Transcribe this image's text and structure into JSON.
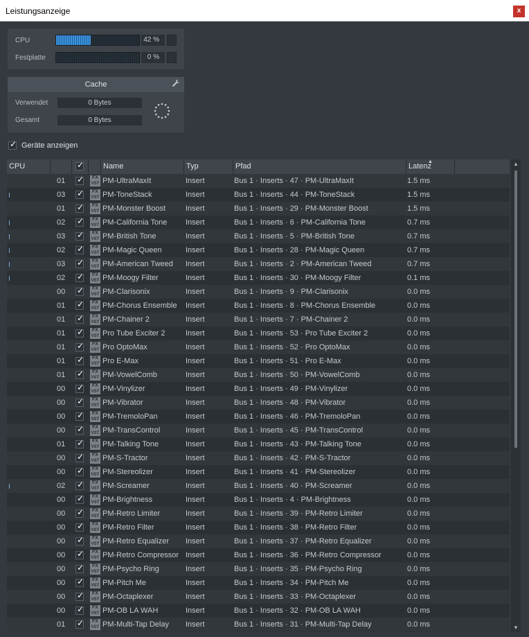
{
  "window": {
    "title": "Leistungsanzeige",
    "close_glyph": "x"
  },
  "meters": {
    "cpu": {
      "label": "CPU",
      "value_text": "42 %",
      "fraction": 0.42
    },
    "disk": {
      "label": "Festplatte",
      "value_text": "0 %",
      "fraction": 0.0
    }
  },
  "cache": {
    "title": "Cache",
    "icon": "wrench-icon",
    "used_label": "Verwendet",
    "used_value": "0 Bytes",
    "total_label": "Gesamt",
    "total_value": "0 Bytes"
  },
  "show_devices": {
    "label": "Geräte anzeigen",
    "checked": true
  },
  "table": {
    "columns": {
      "cpu": "CPU",
      "name": "Name",
      "type": "Typ",
      "path": "Pfad",
      "latency": "Latenz"
    },
    "rows": [
      {
        "cpu": "",
        "num": "01",
        "name": "PM-UltraMaxIt",
        "type": "Insert",
        "path": "Bus 1 · Inserts · 47 · PM-UltraMaxIt",
        "lat": "1.5 ms"
      },
      {
        "cpu": "bar",
        "num": "03",
        "name": "PM-ToneStack",
        "type": "Insert",
        "path": "Bus 1 · Inserts · 44 · PM-ToneStack",
        "lat": "1.5 ms"
      },
      {
        "cpu": "",
        "num": "01",
        "name": "PM-Monster Boost",
        "type": "Insert",
        "path": "Bus 1 · Inserts · 29 · PM-Monster Boost",
        "lat": "1.5 ms"
      },
      {
        "cpu": "bar",
        "num": "02",
        "name": "PM-California Tone",
        "type": "Insert",
        "path": "Bus 1 · Inserts · 6 · PM-California Tone",
        "lat": "0.7 ms"
      },
      {
        "cpu": "bar",
        "num": "03",
        "name": "PM-British Tone",
        "type": "Insert",
        "path": "Bus 1 · Inserts · 5 · PM-British Tone",
        "lat": "0.7 ms"
      },
      {
        "cpu": "bar",
        "num": "02",
        "name": "PM-Magic Queen",
        "type": "Insert",
        "path": "Bus 1 · Inserts · 28 · PM-Magic Queen",
        "lat": "0.7 ms"
      },
      {
        "cpu": "bar",
        "num": "03",
        "name": "PM-American Tweed",
        "type": "Insert",
        "path": "Bus 1 · Inserts · 2 · PM-American Tweed",
        "lat": "0.7 ms"
      },
      {
        "cpu": "bar",
        "num": "02",
        "name": "PM-Moogy Filter",
        "type": "Insert",
        "path": "Bus 1 · Inserts · 30 · PM-Moogy Filter",
        "lat": "0.1 ms"
      },
      {
        "cpu": "",
        "num": "00",
        "name": "PM-Clarisonix",
        "type": "Insert",
        "path": "Bus 1 · Inserts · 9 · PM-Clarisonix",
        "lat": "0.0 ms"
      },
      {
        "cpu": "",
        "num": "01",
        "name": "PM-Chorus Ensemble",
        "type": "Insert",
        "path": "Bus 1 · Inserts · 8 · PM-Chorus Ensemble",
        "lat": "0.0 ms"
      },
      {
        "cpu": "",
        "num": "01",
        "name": "PM-Chainer 2",
        "type": "Insert",
        "path": "Bus 1 · Inserts · 7 · PM-Chainer 2",
        "lat": "0.0 ms"
      },
      {
        "cpu": "",
        "num": "01",
        "name": "Pro Tube Exciter 2",
        "type": "Insert",
        "path": "Bus 1 · Inserts · 53 · Pro Tube Exciter 2",
        "lat": "0.0 ms"
      },
      {
        "cpu": "",
        "num": "01",
        "name": "Pro OptoMax",
        "type": "Insert",
        "path": "Bus 1 · Inserts · 52 · Pro OptoMax",
        "lat": "0.0 ms"
      },
      {
        "cpu": "",
        "num": "01",
        "name": "Pro E-Max",
        "type": "Insert",
        "path": "Bus 1 · Inserts · 51 · Pro E-Max",
        "lat": "0.0 ms"
      },
      {
        "cpu": "",
        "num": "01",
        "name": "PM-VowelComb",
        "type": "Insert",
        "path": "Bus 1 · Inserts · 50 · PM-VowelComb",
        "lat": "0.0 ms"
      },
      {
        "cpu": "",
        "num": "00",
        "name": "PM-Vinylizer",
        "type": "Insert",
        "path": "Bus 1 · Inserts · 49 · PM-Vinylizer",
        "lat": "0.0 ms"
      },
      {
        "cpu": "",
        "num": "00",
        "name": "PM-Vibrator",
        "type": "Insert",
        "path": "Bus 1 · Inserts · 48 · PM-Vibrator",
        "lat": "0.0 ms"
      },
      {
        "cpu": "",
        "num": "00",
        "name": "PM-TremoloPan",
        "type": "Insert",
        "path": "Bus 1 · Inserts · 46 · PM-TremoloPan",
        "lat": "0.0 ms"
      },
      {
        "cpu": "",
        "num": "00",
        "name": "PM-TransControl",
        "type": "Insert",
        "path": "Bus 1 · Inserts · 45 · PM-TransControl",
        "lat": "0.0 ms"
      },
      {
        "cpu": "",
        "num": "01",
        "name": "PM-Talking Tone",
        "type": "Insert",
        "path": "Bus 1 · Inserts · 43 · PM-Talking Tone",
        "lat": "0.0 ms"
      },
      {
        "cpu": "",
        "num": "00",
        "name": "PM-S-Tractor",
        "type": "Insert",
        "path": "Bus 1 · Inserts · 42 · PM-S-Tractor",
        "lat": "0.0 ms"
      },
      {
        "cpu": "",
        "num": "00",
        "name": "PM-Stereolizer",
        "type": "Insert",
        "path": "Bus 1 · Inserts · 41 · PM-Stereolizer",
        "lat": "0.0 ms"
      },
      {
        "cpu": "bar",
        "num": "02",
        "name": "PM-Screamer",
        "type": "Insert",
        "path": "Bus 1 · Inserts · 40 · PM-Screamer",
        "lat": "0.0 ms"
      },
      {
        "cpu": "",
        "num": "00",
        "name": "PM-Brightness",
        "type": "Insert",
        "path": "Bus 1 · Inserts · 4 · PM-Brightness",
        "lat": "0.0 ms"
      },
      {
        "cpu": "",
        "num": "00",
        "name": "PM-Retro Limiter",
        "type": "Insert",
        "path": "Bus 1 · Inserts · 39 · PM-Retro Limiter",
        "lat": "0.0 ms"
      },
      {
        "cpu": "",
        "num": "00",
        "name": "PM-Retro Filter",
        "type": "Insert",
        "path": "Bus 1 · Inserts · 38 · PM-Retro Filter",
        "lat": "0.0 ms"
      },
      {
        "cpu": "",
        "num": "00",
        "name": "PM-Retro Equalizer",
        "type": "Insert",
        "path": "Bus 1 · Inserts · 37 · PM-Retro Equalizer",
        "lat": "0.0 ms"
      },
      {
        "cpu": "",
        "num": "00",
        "name": "PM-Retro Compressor",
        "type": "Insert",
        "path": "Bus 1 · Inserts · 36 · PM-Retro Compressor",
        "lat": "0.0 ms"
      },
      {
        "cpu": "",
        "num": "00",
        "name": "PM-Psycho Ring",
        "type": "Insert",
        "path": "Bus 1 · Inserts · 35 · PM-Psycho Ring",
        "lat": "0.0 ms"
      },
      {
        "cpu": "",
        "num": "00",
        "name": "PM-Pitch Me",
        "type": "Insert",
        "path": "Bus 1 · Inserts · 34 · PM-Pitch Me",
        "lat": "0.0 ms"
      },
      {
        "cpu": "",
        "num": "00",
        "name": "PM-Octaplexer",
        "type": "Insert",
        "path": "Bus 1 · Inserts · 33 · PM-Octaplexer",
        "lat": "0.0 ms"
      },
      {
        "cpu": "",
        "num": "00",
        "name": "PM-OB LA WAH",
        "type": "Insert",
        "path": "Bus 1 · Inserts · 32 · PM-OB LA WAH",
        "lat": "0.0 ms"
      },
      {
        "cpu": "",
        "num": "01",
        "name": "PM-Multi-Tap Delay",
        "type": "Insert",
        "path": "Bus 1 · Inserts · 31 · PM-Multi-Tap Delay",
        "lat": "0.0 ms"
      }
    ]
  },
  "icons": {
    "fx_icon_top": "FX",
    "fx_icon_bottom": "VST",
    "check": "✓",
    "sort_up": "▲",
    "scroll_up": "▲",
    "scroll_down": "▼",
    "wrench": "🔧"
  }
}
